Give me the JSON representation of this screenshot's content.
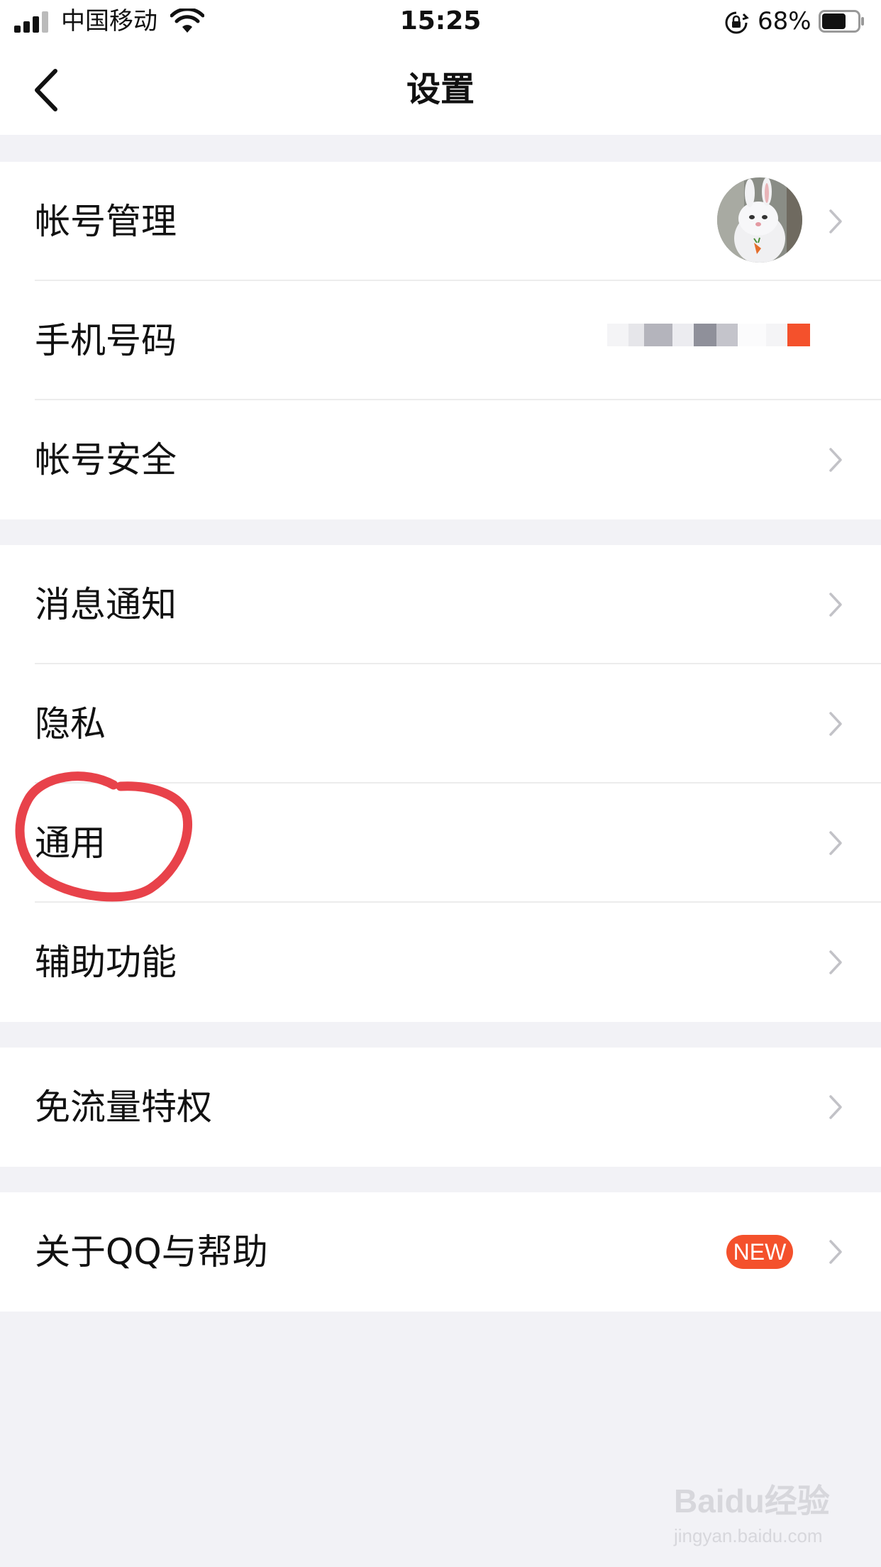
{
  "status_bar": {
    "carrier": "中国移动",
    "time": "15:25",
    "battery_percent": "68%",
    "battery_level": 0.68,
    "icons": [
      "signal-icon",
      "wifi-icon",
      "rotation-lock-icon",
      "battery-icon"
    ]
  },
  "nav": {
    "title": "设置",
    "back_icon": "chevron-left-icon"
  },
  "groups": [
    {
      "items": [
        {
          "label": "帐号管理",
          "accessory": "avatar",
          "chevron": true
        },
        {
          "label": "手机号码",
          "accessory": "masked-phone",
          "chevron": false
        },
        {
          "label": "帐号安全",
          "chevron": true
        }
      ]
    },
    {
      "items": [
        {
          "label": "消息通知",
          "chevron": true
        },
        {
          "label": "隐私",
          "chevron": true
        },
        {
          "label": "通用",
          "chevron": true,
          "annotated": true
        },
        {
          "label": "辅助功能",
          "chevron": true
        }
      ]
    },
    {
      "items": [
        {
          "label": "免流量特权",
          "chevron": true
        }
      ]
    },
    {
      "items": [
        {
          "label": "关于QQ与帮助",
          "badge": "NEW",
          "chevron": true
        }
      ]
    }
  ],
  "colors": {
    "background": "#f2f2f6",
    "cell": "#ffffff",
    "text": "#111111",
    "chevron": "#c2c2c7",
    "badge": "#f4512c",
    "annotation": "#e8424a"
  },
  "watermark": {
    "logo": "Baidu经验",
    "url": "jingyan.baidu.com"
  }
}
